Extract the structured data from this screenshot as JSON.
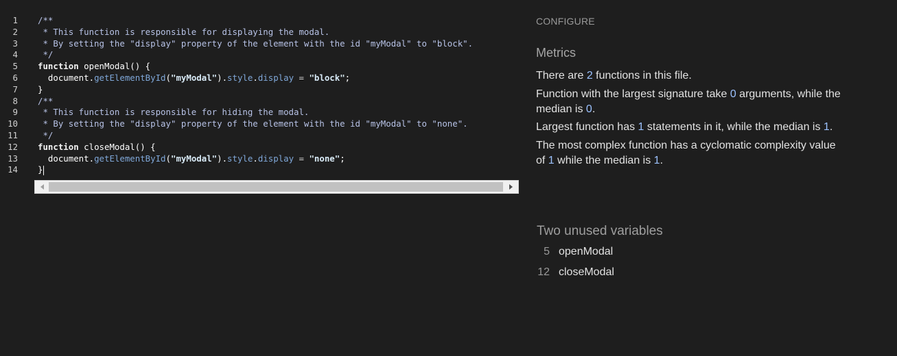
{
  "editor": {
    "lines": [
      {
        "num": "1",
        "tokens": [
          {
            "t": "/**",
            "c": "comment"
          }
        ]
      },
      {
        "num": "2",
        "tokens": [
          {
            "t": " * This function is responsible for displaying the modal.",
            "c": "comment"
          }
        ]
      },
      {
        "num": "3",
        "tokens": [
          {
            "t": " * By setting the \"display\" property of the element with the id \"myModal\" to \"block\".",
            "c": "comment"
          }
        ]
      },
      {
        "num": "4",
        "tokens": [
          {
            "t": " */",
            "c": "comment"
          }
        ]
      },
      {
        "num": "5",
        "tokens": [
          {
            "t": "function",
            "c": "keyword"
          },
          {
            "t": " openModal",
            "c": "ident"
          },
          {
            "t": "() {",
            "c": "punct"
          }
        ]
      },
      {
        "num": "6",
        "tokens": [
          {
            "t": "  document",
            "c": "ident"
          },
          {
            "t": ".",
            "c": "punct"
          },
          {
            "t": "getElementById",
            "c": "method"
          },
          {
            "t": "(",
            "c": "punct"
          },
          {
            "t": "\"myModal\"",
            "c": "string"
          },
          {
            "t": ").",
            "c": "punct"
          },
          {
            "t": "style",
            "c": "method"
          },
          {
            "t": ".",
            "c": "punct"
          },
          {
            "t": "display",
            "c": "method"
          },
          {
            "t": " = ",
            "c": "plain"
          },
          {
            "t": "\"block\"",
            "c": "string"
          },
          {
            "t": ";",
            "c": "punct"
          }
        ]
      },
      {
        "num": "7",
        "tokens": [
          {
            "t": "}",
            "c": "punct"
          }
        ]
      },
      {
        "num": "8",
        "tokens": [
          {
            "t": "/**",
            "c": "comment"
          }
        ]
      },
      {
        "num": "9",
        "tokens": [
          {
            "t": " * This function is responsible for hiding the modal.",
            "c": "comment"
          }
        ]
      },
      {
        "num": "10",
        "tokens": [
          {
            "t": " * By setting the \"display\" property of the element with the id \"myModal\" to \"none\".",
            "c": "comment"
          }
        ]
      },
      {
        "num": "11",
        "tokens": [
          {
            "t": " */",
            "c": "comment"
          }
        ]
      },
      {
        "num": "12",
        "tokens": [
          {
            "t": "function",
            "c": "keyword"
          },
          {
            "t": " closeModal",
            "c": "ident"
          },
          {
            "t": "() {",
            "c": "punct"
          }
        ]
      },
      {
        "num": "13",
        "tokens": [
          {
            "t": "  document",
            "c": "ident"
          },
          {
            "t": ".",
            "c": "punct"
          },
          {
            "t": "getElementById",
            "c": "method"
          },
          {
            "t": "(",
            "c": "punct"
          },
          {
            "t": "\"myModal\"",
            "c": "string"
          },
          {
            "t": ").",
            "c": "punct"
          },
          {
            "t": "style",
            "c": "method"
          },
          {
            "t": ".",
            "c": "punct"
          },
          {
            "t": "display",
            "c": "method"
          },
          {
            "t": " = ",
            "c": "plain"
          },
          {
            "t": "\"none\"",
            "c": "string"
          },
          {
            "t": ";",
            "c": "punct"
          }
        ]
      },
      {
        "num": "14",
        "tokens": [
          {
            "t": "}",
            "c": "punct"
          }
        ],
        "cursor": true
      }
    ]
  },
  "panel": {
    "configure_label": "CONFIGURE",
    "metrics_title": "Metrics",
    "metric_function_count": {
      "pre": "There are ",
      "value": "2",
      "post": " functions in this file."
    },
    "metric_signature": {
      "pre": "Function with the largest signature take ",
      "value1": "0",
      "mid": " arguments, while the median is ",
      "value2": "0",
      "post": "."
    },
    "metric_statements": {
      "pre": "Largest function has ",
      "value1": "1",
      "mid": " statements in it, while the median is ",
      "value2": "1",
      "post": "."
    },
    "metric_complexity": {
      "pre": "The most complex function has a cyclomatic complexity value of ",
      "value1": "1",
      "mid": " while the median is ",
      "value2": "1",
      "post": "."
    },
    "unused_title": "Two unused variables",
    "unused_vars": [
      {
        "line": "5",
        "name": "openModal"
      },
      {
        "line": "12",
        "name": "closeModal"
      }
    ]
  },
  "colors": {
    "background": "#1e1e1e",
    "metric_value": "#9cc2ff",
    "comment": "#b7c2e6",
    "method": "#7fa7d8"
  }
}
